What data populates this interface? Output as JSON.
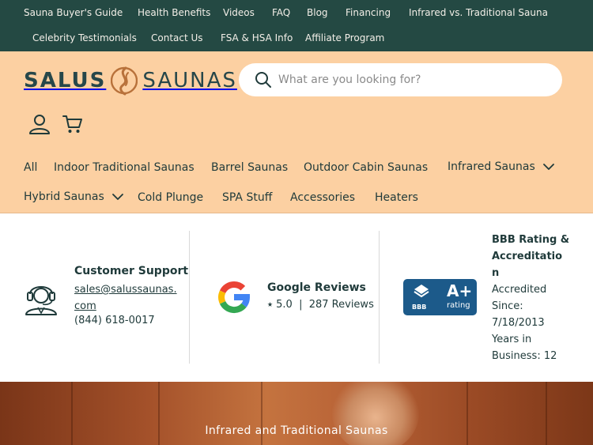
{
  "topbar": {
    "links": [
      "Sauna Buyer's Guide",
      "Health Benefits",
      "Videos",
      "FAQ",
      "Blog",
      "Financing",
      "Infrared vs. Traditional Sauna",
      "Celebrity Testimonials",
      "Contact Us",
      "FSA & HSA Info",
      "Affiliate Program"
    ]
  },
  "logo": {
    "word1": "SALUS",
    "word2": "SAUNAS"
  },
  "search": {
    "placeholder": "What are you looking for?"
  },
  "nav": {
    "items": [
      "All",
      "Indoor Traditional Saunas",
      "Barrel Saunas",
      "Outdoor Cabin Saunas",
      "Infrared Saunas",
      "Hybrid Saunas",
      "Cold Plunge",
      "SPA Stuff",
      "Accessories",
      "Heaters"
    ]
  },
  "trust": {
    "support": {
      "title": "Customer Support",
      "email_line1": "sales@salussaunas.",
      "email_line2": "com",
      "phone": "(844) 618-0017"
    },
    "google": {
      "title": "Google Reviews",
      "rating": "⭑ 5.0  |  287 Reviews"
    },
    "bbb": {
      "title_line1": "BBB Rating &",
      "title_line2": "Accreditatio",
      "title_line3": "n",
      "badge_grade": "A+",
      "badge_word": "rating",
      "badge_brand": "BBB",
      "accredited_line1": "Accredited",
      "accredited_line2": "Since:",
      "accredited_line3": "7/18/2013",
      "years_line1": "Years in",
      "years_line2": "Business: 12"
    }
  },
  "hero": {
    "text": "Infrared and Traditional Saunas"
  },
  "colors": {
    "topbar_bg": "#244943",
    "header_bg": "#fcd0a2",
    "logo_accent": "#b8713a",
    "bbb_blue": "#1c5a8a"
  }
}
